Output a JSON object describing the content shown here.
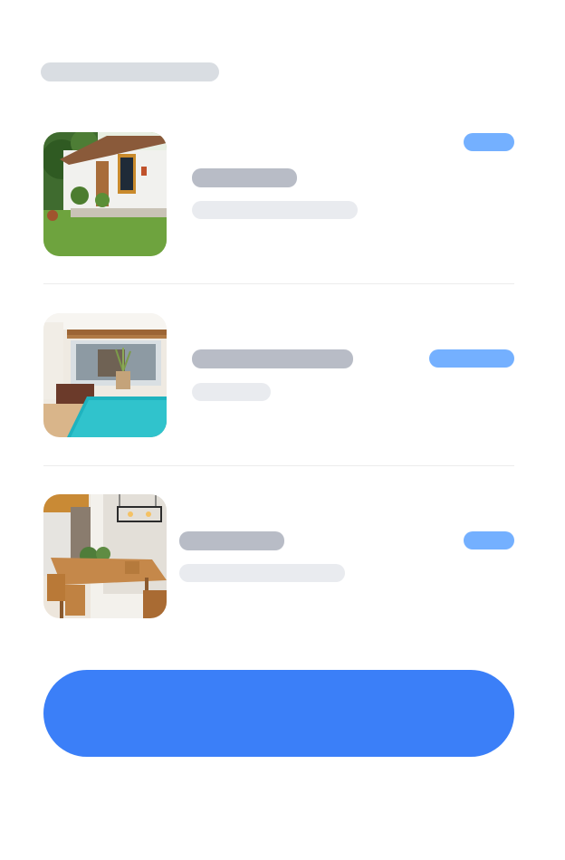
{
  "header": {
    "title": ""
  },
  "listings": [
    {
      "image": "house-exterior-garden",
      "title": "",
      "subtitle": "",
      "badge": ""
    },
    {
      "image": "pool-patio",
      "title": "",
      "subtitle": "",
      "badge": ""
    },
    {
      "image": "dining-room",
      "title": "",
      "subtitle": "",
      "badge": ""
    }
  ],
  "cta": {
    "label": ""
  },
  "colors": {
    "accent": "#3b7ff8",
    "badge": "#74b0ff",
    "skeleton_title": "#b8bcc6",
    "skeleton_subtitle": "#e9ebef",
    "skeleton_header": "#d9dde2"
  }
}
